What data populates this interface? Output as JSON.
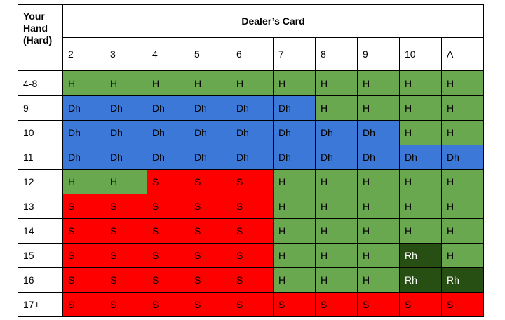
{
  "header": {
    "corner": "Your Hand (Hard)",
    "dealer_title": "Dealer’s Card",
    "dealer_cards": [
      "2",
      "3",
      "4",
      "5",
      "6",
      "7",
      "8",
      "9",
      "10",
      "A"
    ]
  },
  "rows": [
    {
      "hand": "4-8",
      "cells": [
        "H",
        "H",
        "H",
        "H",
        "H",
        "H",
        "H",
        "H",
        "H",
        "H"
      ]
    },
    {
      "hand": "9",
      "cells": [
        "Dh",
        "Dh",
        "Dh",
        "Dh",
        "Dh",
        "Dh",
        "H",
        "H",
        "H",
        "H"
      ]
    },
    {
      "hand": "10",
      "cells": [
        "Dh",
        "Dh",
        "Dh",
        "Dh",
        "Dh",
        "Dh",
        "Dh",
        "Dh",
        "H",
        "H"
      ]
    },
    {
      "hand": "11",
      "cells": [
        "Dh",
        "Dh",
        "Dh",
        "Dh",
        "Dh",
        "Dh",
        "Dh",
        "Dh",
        "Dh",
        "Dh"
      ]
    },
    {
      "hand": "12",
      "cells": [
        "H",
        "H",
        "S",
        "S",
        "S",
        "H",
        "H",
        "H",
        "H",
        "H"
      ]
    },
    {
      "hand": "13",
      "cells": [
        "S",
        "S",
        "S",
        "S",
        "S",
        "H",
        "H",
        "H",
        "H",
        "H"
      ]
    },
    {
      "hand": "14",
      "cells": [
        "S",
        "S",
        "S",
        "S",
        "S",
        "H",
        "H",
        "H",
        "H",
        "H"
      ]
    },
    {
      "hand": "15",
      "cells": [
        "S",
        "S",
        "S",
        "S",
        "S",
        "H",
        "H",
        "H",
        "Rh",
        "H"
      ]
    },
    {
      "hand": "16",
      "cells": [
        "S",
        "S",
        "S",
        "S",
        "S",
        "H",
        "H",
        "H",
        "Rh",
        "Rh"
      ]
    },
    {
      "hand": "17+",
      "cells": [
        "S",
        "S",
        "S",
        "S",
        "S",
        "S",
        "S",
        "S",
        "S",
        "S"
      ]
    }
  ],
  "colors": {
    "H": "#6aa84f",
    "Dh": "#3c78d8",
    "S": "#ff0000",
    "Rh": "#274e13"
  }
}
